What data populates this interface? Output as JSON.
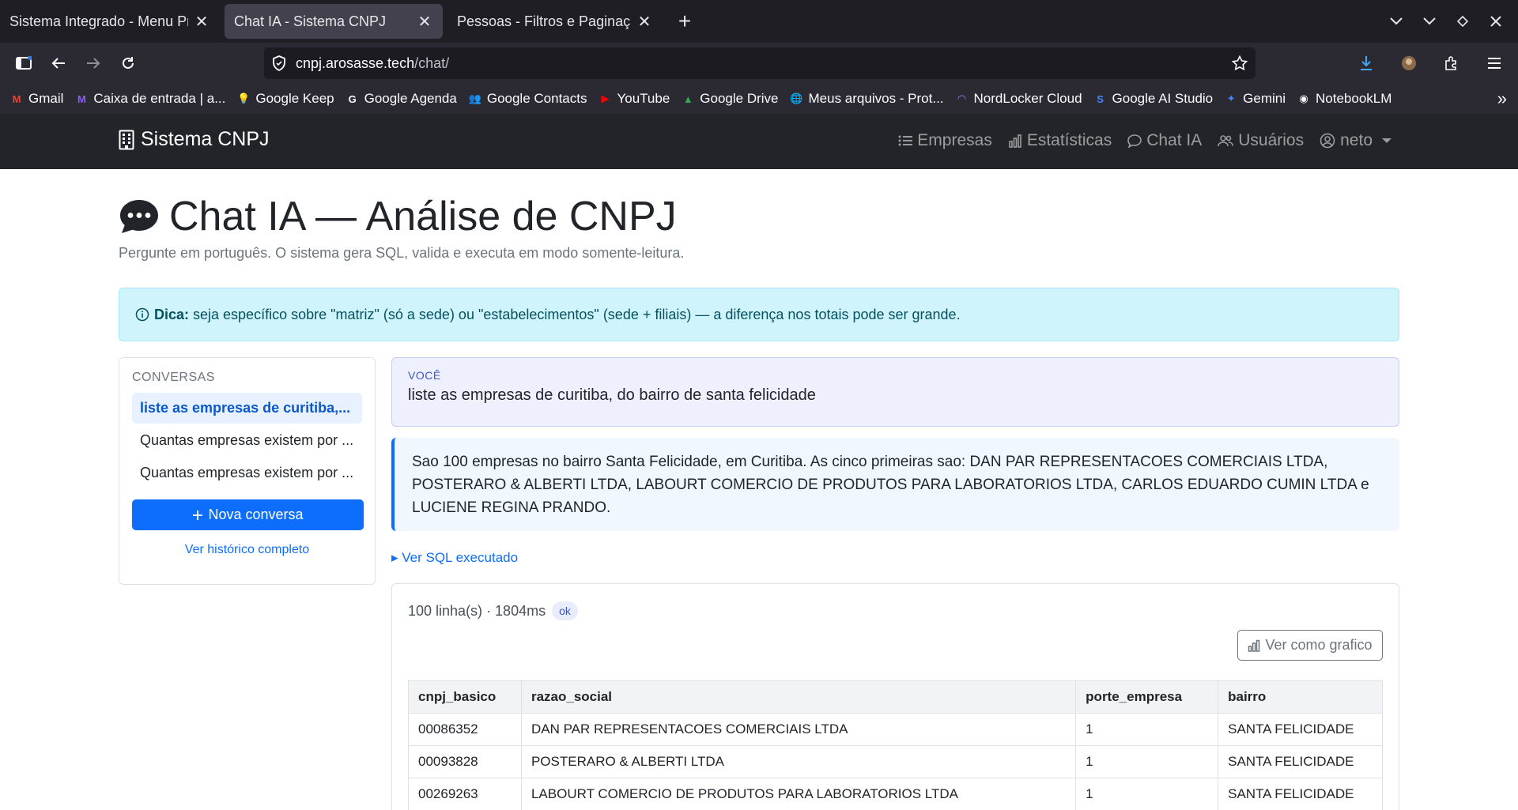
{
  "browser": {
    "tabs": [
      {
        "title": "Sistema Integrado - Menu Principal"
      },
      {
        "title": "Chat IA - Sistema CNPJ"
      },
      {
        "title": "Pessoas - Filtros e Paginação"
      }
    ],
    "url_host": "cnpj.arosasse.tech",
    "url_path": "/chat/",
    "bookmarks": [
      {
        "label": "Gmail",
        "icon": "gmail-icon",
        "glyph": "M",
        "color": "#ea4335"
      },
      {
        "label": "Caixa de entrada | a...",
        "icon": "proton-mail-icon",
        "glyph": "M",
        "color": "#8b5cf6"
      },
      {
        "label": "Google Keep",
        "icon": "google-keep-icon",
        "glyph": "💡",
        "color": "#fbbc04"
      },
      {
        "label": "Google Agenda",
        "icon": "google-icon",
        "glyph": "G",
        "color": "#fbfbfe"
      },
      {
        "label": "Google Contacts",
        "icon": "google-contacts-icon",
        "glyph": "👥",
        "color": "#4285f4"
      },
      {
        "label": "YouTube",
        "icon": "youtube-icon",
        "glyph": "▶",
        "color": "#ff0000"
      },
      {
        "label": "Google Drive",
        "icon": "google-drive-icon",
        "glyph": "▲",
        "color": "#34a853"
      },
      {
        "label": "Meus arquivos - Prot...",
        "icon": "globe-icon",
        "glyph": "🌐",
        "color": "#fbfbfe"
      },
      {
        "label": "NordLocker Cloud",
        "icon": "nordlocker-icon",
        "glyph": "◠",
        "color": "#8b8cf8"
      },
      {
        "label": "Google AI Studio",
        "icon": "ai-studio-icon",
        "glyph": "S",
        "color": "#4285f4"
      },
      {
        "label": "Gemini",
        "icon": "gemini-icon",
        "glyph": "✦",
        "color": "#4285f4"
      },
      {
        "label": "NotebookLM",
        "icon": "notebooklm-icon",
        "glyph": "◉",
        "color": "#fbfbfe"
      }
    ]
  },
  "app": {
    "brand": "Sistema CNPJ",
    "menu": [
      {
        "label": "Empresas",
        "icon": "list-icon"
      },
      {
        "label": "Estatísticas",
        "icon": "bar-chart-icon"
      },
      {
        "label": "Chat IA",
        "icon": "chat-icon"
      },
      {
        "label": "Usuários",
        "icon": "users-icon"
      }
    ],
    "user": "neto"
  },
  "page": {
    "title": "Chat IA — Análise de CNPJ",
    "subtitle": "Pergunte em português. O sistema gera SQL, valida e executa em modo somente-leitura.",
    "tip_label": "Dica:",
    "tip_text": " seja específico sobre \"matriz\" (só a sede) ou \"estabelecimentos\" (sede + filiais) — a diferença nos totais pode ser grande."
  },
  "sidebar": {
    "heading": "CONVERSAS",
    "conversations": [
      {
        "label": "liste as empresas de curitiba,...",
        "active": true
      },
      {
        "label": "Quantas empresas existem por ...",
        "active": false
      },
      {
        "label": "Quantas empresas existem por ...",
        "active": false
      }
    ],
    "new_label": "Nova conversa",
    "history_label": "Ver histórico completo"
  },
  "chat": {
    "user_label": "VOCÊ",
    "user_message": "liste as empresas de curitiba, do bairro de santa felicidade",
    "answer": "Sao 100 empresas no bairro Santa Felicidade, em Curitiba. As cinco primeiras sao: DAN PAR REPRESENTACOES COMERCIAIS LTDA, POSTERARO & ALBERTI LTDA, LABOURT COMERCIO DE PRODUTOS PARA LABORATORIOS LTDA, CARLOS EDUARDO CUMIN LTDA e LUCIENE REGINA PRANDO.",
    "sql_toggle": "▸ Ver SQL executado",
    "result_meta": "100 linha(s) · 1804ms",
    "status_badge": "ok",
    "chart_button": "Ver como grafico",
    "columns": [
      "cnpj_basico",
      "razao_social",
      "porte_empresa",
      "bairro"
    ],
    "rows": [
      [
        "00086352",
        "DAN PAR REPRESENTACOES COMERCIAIS LTDA",
        "1",
        "SANTA FELICIDADE"
      ],
      [
        "00093828",
        "POSTERARO & ALBERTI LTDA",
        "1",
        "SANTA FELICIDADE"
      ],
      [
        "00269263",
        "LABOURT COMERCIO DE PRODUTOS PARA LABORATORIOS LTDA",
        "1",
        "SANTA FELICIDADE"
      ]
    ]
  }
}
